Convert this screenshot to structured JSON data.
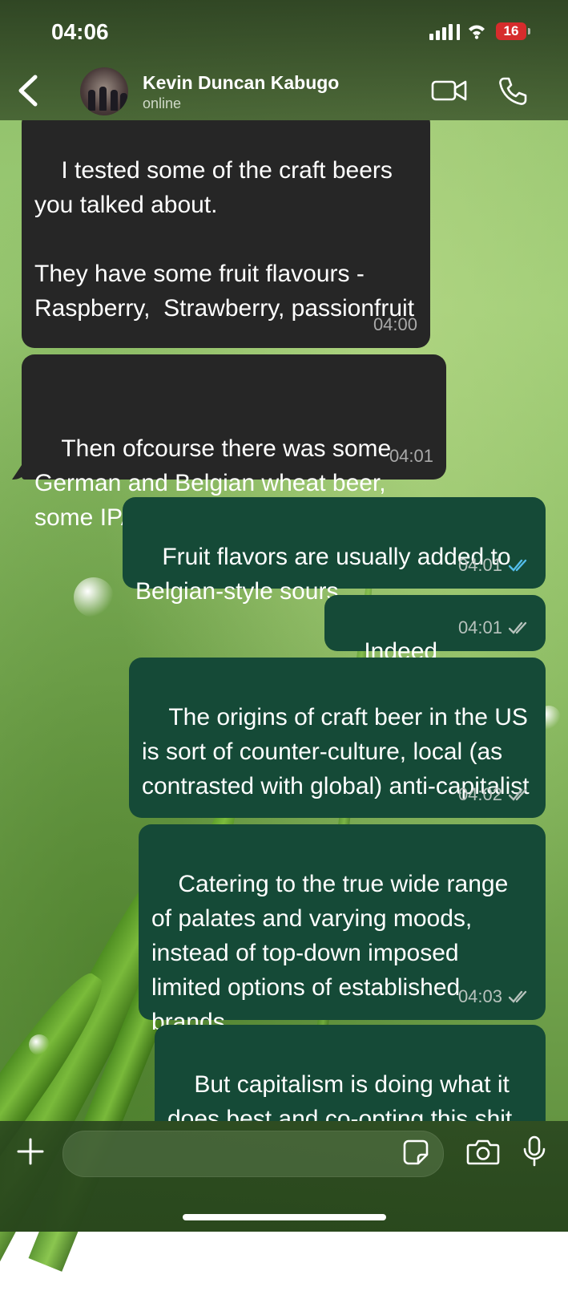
{
  "status_bar": {
    "time": "04:06",
    "battery": "16"
  },
  "contact": {
    "name": "Kevin Duncan Kabugo",
    "status": "online"
  },
  "messages": [
    {
      "direction": "incoming",
      "text": "I tested some of the craft beers you talked about.\n\nThey have some fruit flavours -Raspberry,  Strawberry, passionfruit",
      "time": "04:00"
    },
    {
      "direction": "incoming",
      "text": "Then ofcourse there was some German and Belgian wheat beer, some IPA",
      "time": "04:01"
    },
    {
      "direction": "outgoing",
      "text": "Fruit flavors are usually added to Belgian-style sours",
      "time": "04:01",
      "receipt": "read"
    },
    {
      "direction": "outgoing",
      "text": "Indeed",
      "time": "04:01",
      "receipt": "delivered"
    },
    {
      "direction": "outgoing",
      "text": "The origins of craft beer in the US is sort of counter-culture, local (as contrasted with global) anti-capitalist",
      "time": "04:02",
      "receipt": "delivered"
    },
    {
      "direction": "outgoing",
      "text": "Catering to the true wide range of palates and varying moods, instead of top-down imposed limited options of established brands",
      "time": "04:03",
      "receipt": "delivered"
    },
    {
      "direction": "outgoing",
      "text": "But capitalism is doing what it does best and co-opting this shit :)",
      "time": "",
      "receipt": ""
    }
  ],
  "composer": {
    "placeholder": ""
  },
  "colors": {
    "incoming_bubble": "#262626",
    "outgoing_bubble": "#154a37",
    "read_tick": "#53bdeb",
    "delivered_tick": "#b7c2bd"
  },
  "icons": [
    "back-chevron-icon",
    "video-call-icon",
    "voice-call-icon",
    "plus-icon",
    "sticker-icon",
    "camera-icon",
    "microphone-icon"
  ]
}
